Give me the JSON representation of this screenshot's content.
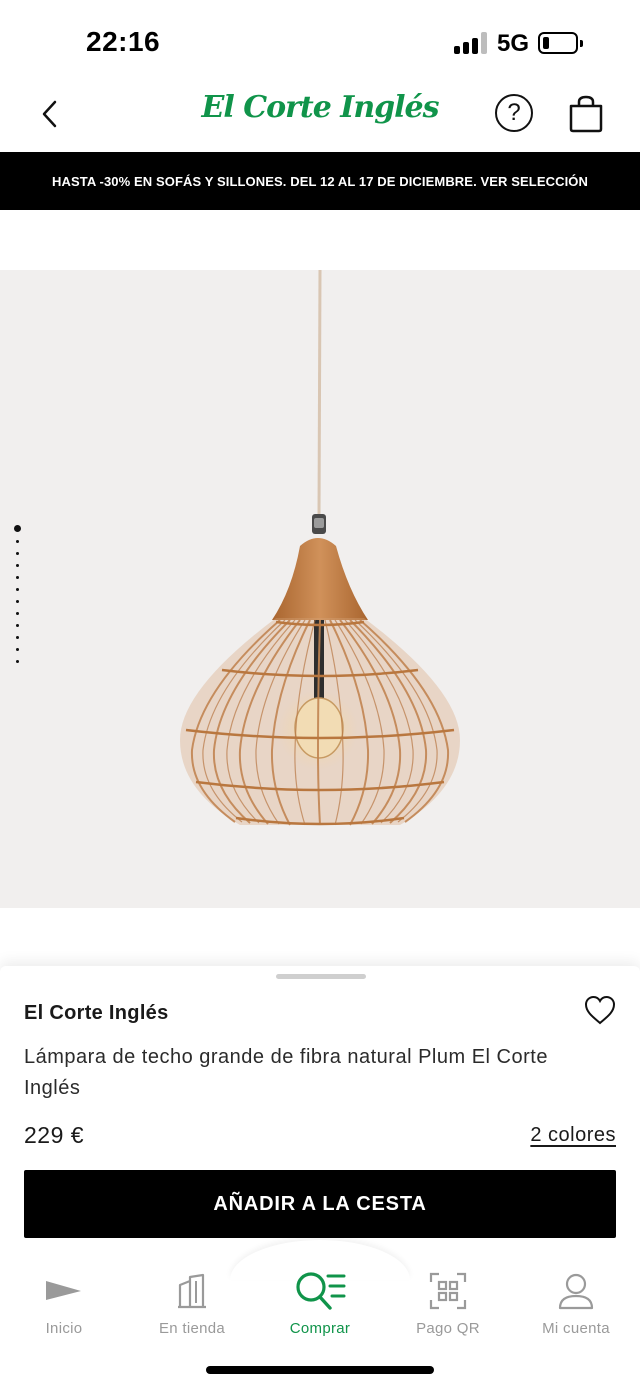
{
  "status_bar": {
    "time": "22:16",
    "network": "5G",
    "battery_level": 0.2
  },
  "header": {
    "back_icon": "chevron-left-icon",
    "logo_text": "El Corte Inglés",
    "help_icon": "question-circle-icon",
    "help_glyph": "?",
    "bag_icon": "shopping-bag-icon"
  },
  "promo": {
    "text": "HASTA -30% EN SOFÁS Y SILLONES. DEL 12 AL 17 DE DICIEMBRE. VER SELECCIÓN"
  },
  "gallery": {
    "image_icon": "pendant-lamp-image",
    "total_images": 12,
    "active_index": 0
  },
  "product": {
    "brand": "El Corte Inglés",
    "name": "Lámpara de techo grande de fibra natural Plum El Corte Inglés",
    "price": "229 €",
    "colors_link": "2 colores",
    "favorite_icon": "heart-outline-icon",
    "add_to_cart_label": "AÑADIR A LA CESTA"
  },
  "tab_bar": {
    "active": "Comprar",
    "tabs": [
      {
        "label": "Inicio",
        "icon": "inicio-triangle-icon"
      },
      {
        "label": "En tienda",
        "icon": "store-building-icon"
      },
      {
        "label": "Comprar",
        "icon": "search-list-icon"
      },
      {
        "label": "Pago QR",
        "icon": "qr-code-icon"
      },
      {
        "label": "Mi cuenta",
        "icon": "user-account-icon"
      }
    ]
  },
  "colors": {
    "brand_green": "#10944a",
    "promo_bg": "#000000",
    "image_bg": "#f1efee",
    "rattan": "#c98f5e",
    "wood": "#c27d48"
  }
}
